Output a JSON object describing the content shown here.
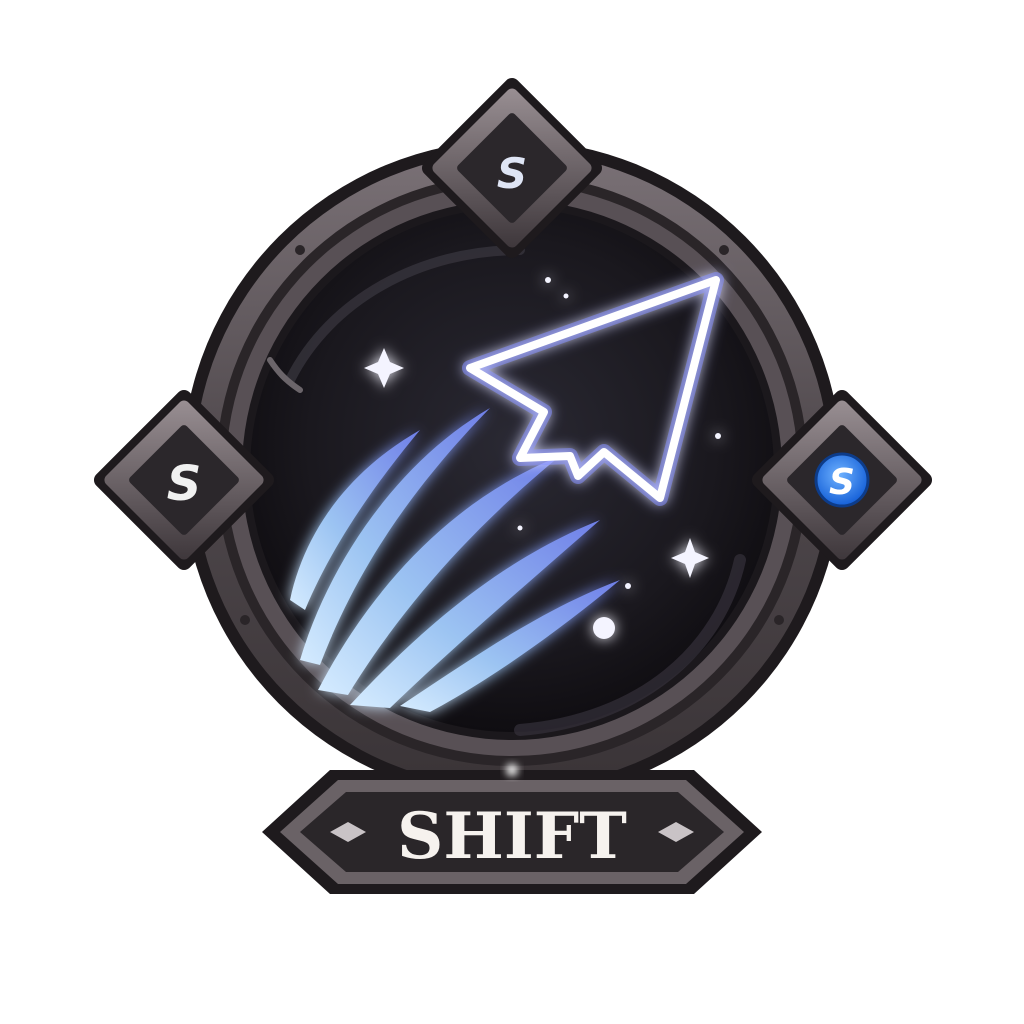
{
  "ability": {
    "name": "SHIFT",
    "icon": "dash-arrow-icon"
  },
  "gems": [
    {
      "position": "top",
      "letter": "S",
      "state": "inactive"
    },
    {
      "position": "left",
      "letter": "S",
      "state": "inactive"
    },
    {
      "position": "right",
      "letter": "S",
      "state": "active"
    }
  ],
  "colors": {
    "frame": "#5a5256",
    "frame_dark": "#1e1a1d",
    "core": "#1c1a22",
    "glow": "#7f8cff",
    "streak": "#8fb8f0",
    "active_gem": "#2b7ff0",
    "label_text": "#f6f2ee"
  }
}
